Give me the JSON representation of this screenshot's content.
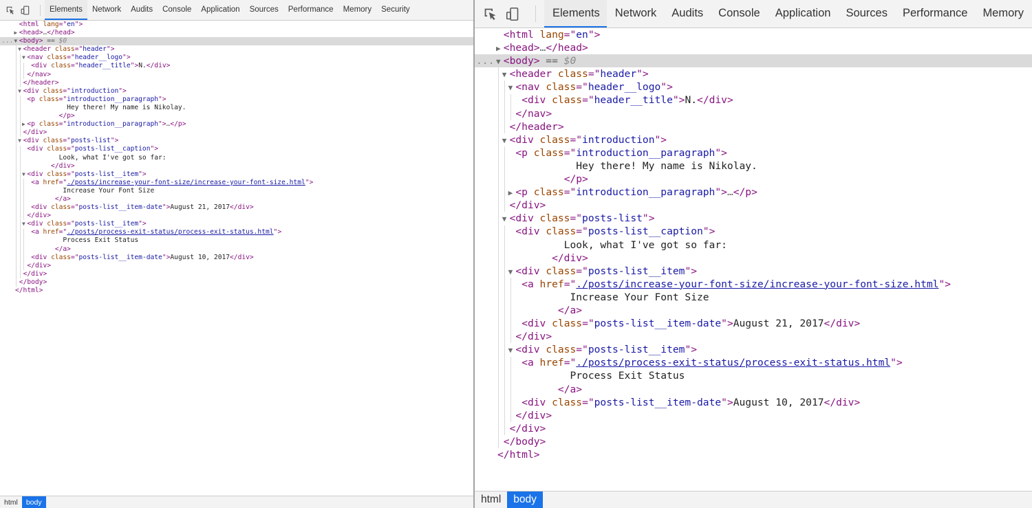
{
  "toolbar": {
    "inspect_icon": "inspect-element-icon",
    "device_icon": "device-toolbar-icon",
    "tabs_left": [
      {
        "label": "Elements",
        "active": true
      },
      {
        "label": "Network"
      },
      {
        "label": "Audits"
      },
      {
        "label": "Console"
      },
      {
        "label": "Application"
      },
      {
        "label": "Sources"
      },
      {
        "label": "Performance"
      },
      {
        "label": "Memory"
      },
      {
        "label": "Security"
      }
    ],
    "tabs_right": [
      {
        "label": "Elements",
        "active": true
      },
      {
        "label": "Network"
      },
      {
        "label": "Audits"
      },
      {
        "label": "Console"
      },
      {
        "label": "Application"
      },
      {
        "label": "Sources"
      },
      {
        "label": "Performance"
      },
      {
        "label": "Memory"
      }
    ]
  },
  "dom_tree": [
    {
      "depth": 0,
      "arrow": "",
      "parts": [
        [
          "t",
          "<html "
        ],
        [
          "a",
          "lang"
        ],
        [
          "t",
          "=\""
        ],
        [
          "v",
          "en"
        ],
        [
          "t",
          "\">"
        ]
      ]
    },
    {
      "depth": 0,
      "arrow": "right",
      "parts": [
        [
          "t",
          "<head>"
        ],
        [
          "d",
          "…"
        ],
        [
          "t",
          "</head>"
        ]
      ]
    },
    {
      "depth": 0,
      "arrow": "down",
      "selected": true,
      "dots": "...",
      "parts": [
        [
          "t",
          "<body>"
        ],
        [
          "e",
          " == "
        ],
        [
          "s",
          "$0"
        ]
      ]
    },
    {
      "depth": 1,
      "arrow": "down",
      "parts": [
        [
          "t",
          "<header "
        ],
        [
          "a",
          "class"
        ],
        [
          "t",
          "=\""
        ],
        [
          "v",
          "header"
        ],
        [
          "t",
          "\">"
        ]
      ]
    },
    {
      "depth": 2,
      "arrow": "down",
      "parts": [
        [
          "t",
          "<nav "
        ],
        [
          "a",
          "class"
        ],
        [
          "t",
          "=\""
        ],
        [
          "v",
          "header__logo"
        ],
        [
          "t",
          "\">"
        ]
      ]
    },
    {
      "depth": 3,
      "arrow": "",
      "parts": [
        [
          "t",
          "<div "
        ],
        [
          "a",
          "class"
        ],
        [
          "t",
          "=\""
        ],
        [
          "v",
          "header__title"
        ],
        [
          "t",
          "\">"
        ],
        [
          "x",
          "N."
        ],
        [
          "t",
          "</div>"
        ]
      ]
    },
    {
      "depth": 2,
      "arrow": "",
      "parts": [
        [
          "t",
          "</nav>"
        ]
      ]
    },
    {
      "depth": 1,
      "arrow": "",
      "parts": [
        [
          "t",
          "</header>"
        ]
      ]
    },
    {
      "depth": 1,
      "arrow": "down",
      "parts": [
        [
          "t",
          "<div "
        ],
        [
          "a",
          "class"
        ],
        [
          "t",
          "=\""
        ],
        [
          "v",
          "introduction"
        ],
        [
          "t",
          "\">"
        ]
      ]
    },
    {
      "depth": 2,
      "arrow": "",
      "parts": [
        [
          "t",
          "<p "
        ],
        [
          "a",
          "class"
        ],
        [
          "t",
          "=\""
        ],
        [
          "v",
          "introduction__paragraph"
        ],
        [
          "t",
          "\">"
        ]
      ]
    },
    {
      "depth": 2,
      "arrow": "",
      "parts": [
        [
          "x",
          "          Hey there! My name is Nikolay."
        ]
      ]
    },
    {
      "depth": 2,
      "arrow": "",
      "parts": [
        [
          "x",
          "        "
        ],
        [
          "t",
          "</p>"
        ]
      ]
    },
    {
      "depth": 2,
      "arrow": "right",
      "parts": [
        [
          "t",
          "<p "
        ],
        [
          "a",
          "class"
        ],
        [
          "t",
          "=\""
        ],
        [
          "v",
          "introduction__paragraph"
        ],
        [
          "t",
          "\">"
        ],
        [
          "d",
          "…"
        ],
        [
          "t",
          "</p>"
        ]
      ]
    },
    {
      "depth": 1,
      "arrow": "",
      "parts": [
        [
          "t",
          "</div>"
        ]
      ]
    },
    {
      "depth": 1,
      "arrow": "down",
      "parts": [
        [
          "t",
          "<div "
        ],
        [
          "a",
          "class"
        ],
        [
          "t",
          "=\""
        ],
        [
          "v",
          "posts-list"
        ],
        [
          "t",
          "\">"
        ]
      ]
    },
    {
      "depth": 2,
      "arrow": "",
      "parts": [
        [
          "t",
          "<div "
        ],
        [
          "a",
          "class"
        ],
        [
          "t",
          "=\""
        ],
        [
          "v",
          "posts-list__caption"
        ],
        [
          "t",
          "\">"
        ]
      ]
    },
    {
      "depth": 2,
      "arrow": "",
      "parts": [
        [
          "x",
          "        Look, what I've got so far:"
        ]
      ]
    },
    {
      "depth": 2,
      "arrow": "",
      "parts": [
        [
          "x",
          "      "
        ],
        [
          "t",
          "</div>"
        ]
      ]
    },
    {
      "depth": 2,
      "arrow": "down",
      "parts": [
        [
          "t",
          "<div "
        ],
        [
          "a",
          "class"
        ],
        [
          "t",
          "=\""
        ],
        [
          "v",
          "posts-list__item"
        ],
        [
          "t",
          "\">"
        ]
      ]
    },
    {
      "depth": 3,
      "arrow": "",
      "parts": [
        [
          "t",
          "<a "
        ],
        [
          "a",
          "href"
        ],
        [
          "t",
          "=\""
        ],
        [
          "l",
          "./posts/increase-your-font-size/increase-your-font-size.html"
        ],
        [
          "t",
          "\">"
        ]
      ]
    },
    {
      "depth": 3,
      "arrow": "",
      "parts": [
        [
          "x",
          "        Increase Your Font Size"
        ]
      ]
    },
    {
      "depth": 3,
      "arrow": "",
      "parts": [
        [
          "x",
          "      "
        ],
        [
          "t",
          "</a>"
        ]
      ]
    },
    {
      "depth": 3,
      "arrow": "",
      "parts": [
        [
          "t",
          "<div "
        ],
        [
          "a",
          "class"
        ],
        [
          "t",
          "=\""
        ],
        [
          "v",
          "posts-list__item-date"
        ],
        [
          "t",
          "\">"
        ],
        [
          "x",
          "August 21, 2017"
        ],
        [
          "t",
          "</div>"
        ]
      ]
    },
    {
      "depth": 2,
      "arrow": "",
      "parts": [
        [
          "t",
          "</div>"
        ]
      ]
    },
    {
      "depth": 2,
      "arrow": "down",
      "parts": [
        [
          "t",
          "<div "
        ],
        [
          "a",
          "class"
        ],
        [
          "t",
          "=\""
        ],
        [
          "v",
          "posts-list__item"
        ],
        [
          "t",
          "\">"
        ]
      ]
    },
    {
      "depth": 3,
      "arrow": "",
      "parts": [
        [
          "t",
          "<a "
        ],
        [
          "a",
          "href"
        ],
        [
          "t",
          "=\""
        ],
        [
          "l",
          "./posts/process-exit-status/process-exit-status.html"
        ],
        [
          "t",
          "\">"
        ]
      ]
    },
    {
      "depth": 3,
      "arrow": "",
      "parts": [
        [
          "x",
          "        Process Exit Status"
        ]
      ]
    },
    {
      "depth": 3,
      "arrow": "",
      "parts": [
        [
          "x",
          "      "
        ],
        [
          "t",
          "</a>"
        ]
      ]
    },
    {
      "depth": 3,
      "arrow": "",
      "parts": [
        [
          "t",
          "<div "
        ],
        [
          "a",
          "class"
        ],
        [
          "t",
          "=\""
        ],
        [
          "v",
          "posts-list__item-date"
        ],
        [
          "t",
          "\">"
        ],
        [
          "x",
          "August 10, 2017"
        ],
        [
          "t",
          "</div>"
        ]
      ]
    },
    {
      "depth": 2,
      "arrow": "",
      "parts": [
        [
          "t",
          "</div>"
        ]
      ]
    },
    {
      "depth": 1,
      "arrow": "",
      "parts": [
        [
          "t",
          "</div>"
        ]
      ]
    },
    {
      "depth": 0,
      "arrow": "",
      "parts": [
        [
          "t",
          "</body>"
        ]
      ]
    },
    {
      "depth": -1,
      "arrow": "",
      "parts": [
        [
          "t",
          "</html>"
        ]
      ]
    }
  ],
  "breadcrumbs": [
    {
      "label": "html"
    },
    {
      "label": "body",
      "active": true
    }
  ]
}
